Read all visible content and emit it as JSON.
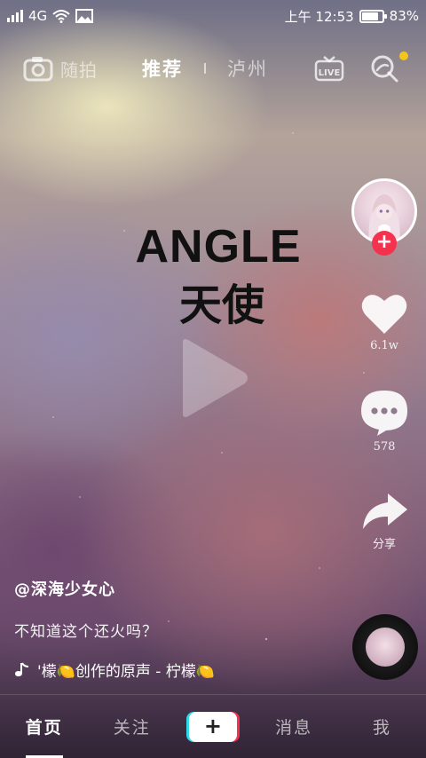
{
  "status_bar": {
    "network": "4G",
    "time": "上午 12:53",
    "battery": "83%",
    "battery_level": 0.83
  },
  "top_nav": {
    "camera_label": "随拍",
    "tabs": [
      {
        "label": "推荐",
        "active": true
      },
      {
        "label": "泸州",
        "active": false
      }
    ],
    "has_notification": true
  },
  "video": {
    "title_en": "ANGLE",
    "title_zh": "天使"
  },
  "actions": {
    "like_count": "6.1w",
    "comment_count": "578",
    "share_label": "分享"
  },
  "info": {
    "author": "@深海少女心",
    "caption": "不知道这个还火吗？",
    "music": "'檬🍋创作的原声 - 柠檬🍋"
  },
  "bottom_nav": {
    "items": [
      "首页",
      "关注",
      "+",
      "消息",
      "我"
    ]
  },
  "colors": {
    "follow": "#f4324e",
    "notification": "#f5c518",
    "accent_cyan": "#30d8e8"
  }
}
